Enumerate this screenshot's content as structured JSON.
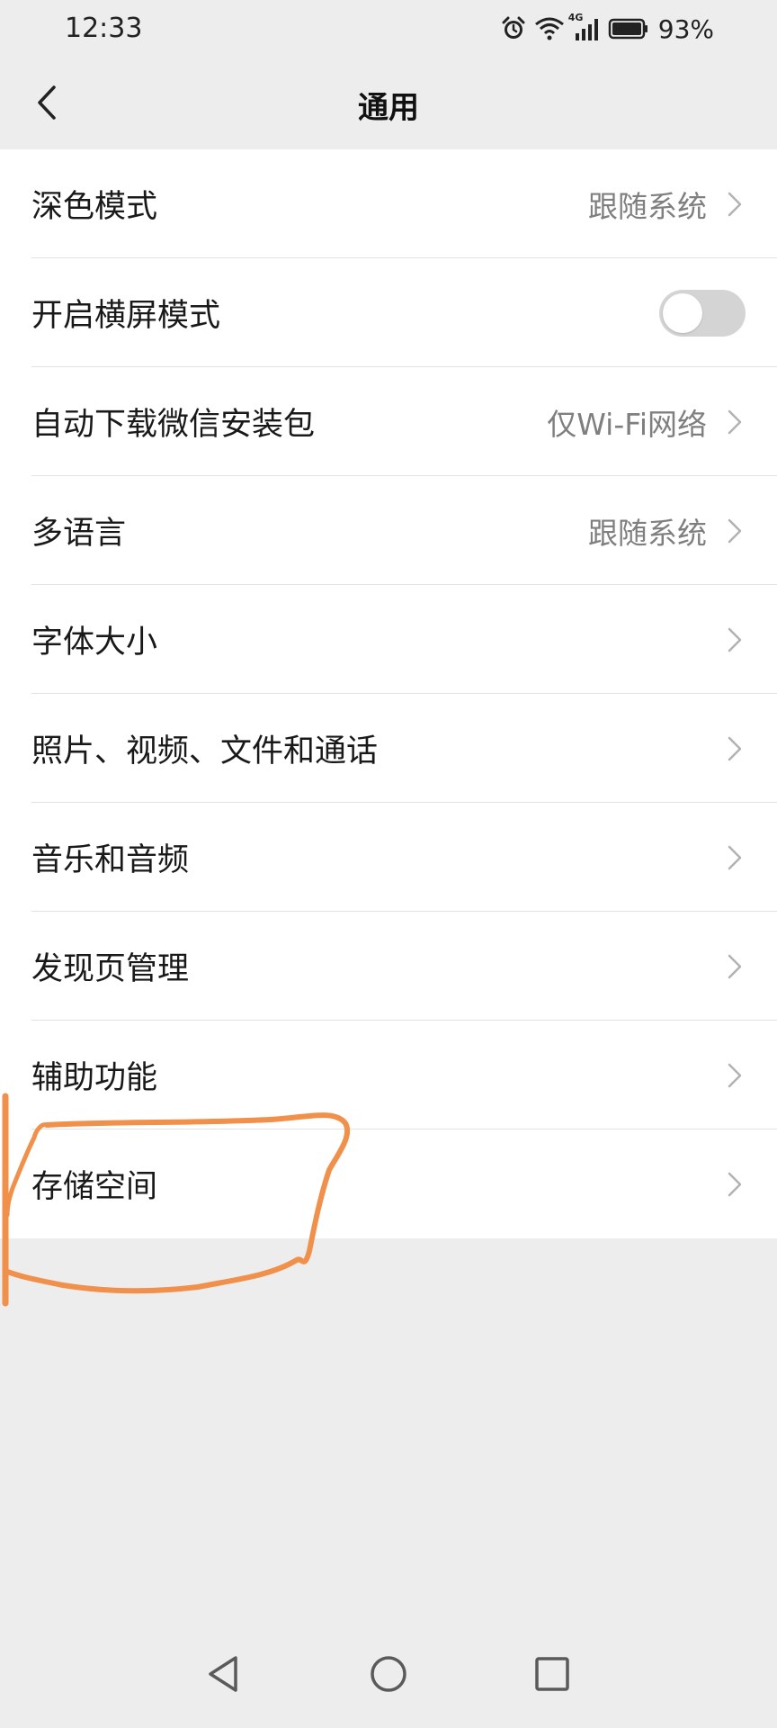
{
  "status_bar": {
    "time": "12:33",
    "network": "4G",
    "battery_percent": "93%"
  },
  "nav": {
    "title": "通用"
  },
  "settings": [
    {
      "label": "深色模式",
      "value": "跟随系统",
      "type": "link"
    },
    {
      "label": "开启横屏模式",
      "value": "",
      "type": "toggle",
      "toggle_on": false
    },
    {
      "label": "自动下载微信安装包",
      "value": "仅Wi-Fi网络",
      "type": "link"
    },
    {
      "label": "多语言",
      "value": "跟随系统",
      "type": "link"
    },
    {
      "label": "字体大小",
      "value": "",
      "type": "link"
    },
    {
      "label": "照片、视频、文件和通话",
      "value": "",
      "type": "link"
    },
    {
      "label": "音乐和音频",
      "value": "",
      "type": "link"
    },
    {
      "label": "发现页管理",
      "value": "",
      "type": "link"
    },
    {
      "label": "辅助功能",
      "value": "",
      "type": "link"
    },
    {
      "label": "存储空间",
      "value": "",
      "type": "link"
    }
  ],
  "colors": {
    "background": "#ededed",
    "card": "#ffffff",
    "annotation_stroke": "#f0904a",
    "toggle_off": "#d4d4d4"
  },
  "icons": {
    "back": "chevron-left-icon",
    "row_arrow": "chevron-right-icon",
    "system_back": "triangle-back-icon",
    "system_home": "circle-home-icon",
    "system_recents": "square-recents-icon"
  }
}
